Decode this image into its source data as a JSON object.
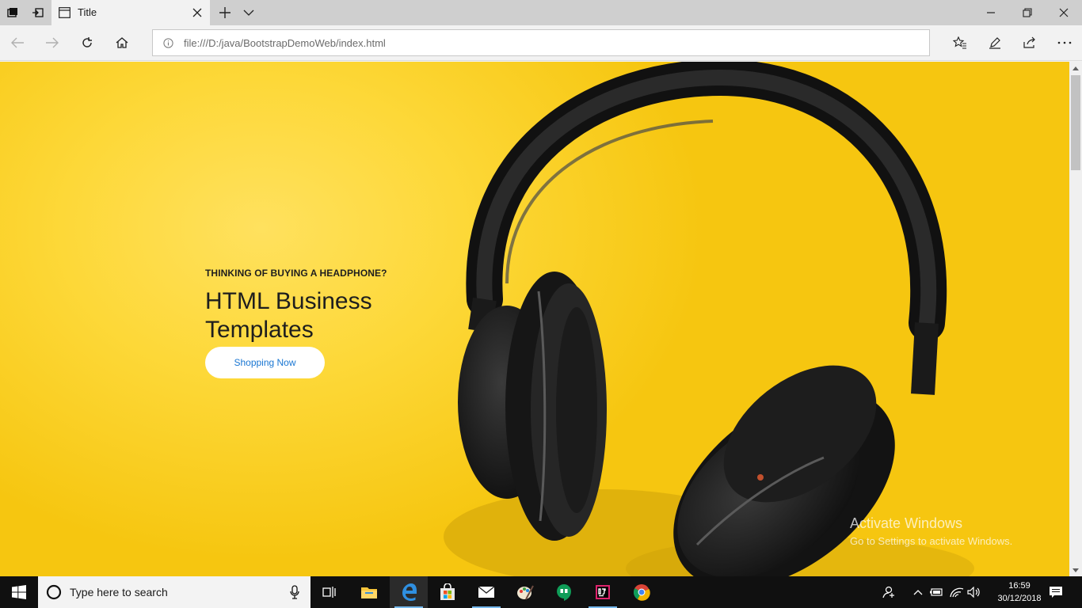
{
  "tab": {
    "title": "Title"
  },
  "address_bar": {
    "url": "file:///D:/java/BootstrapDemoWeb/index.html"
  },
  "page": {
    "eyebrow": "THINKING OF BUYING A HEADPHONE?",
    "headline": "HTML Business Templates",
    "cta_label": "Shopping Now"
  },
  "watermark": {
    "line1": "Activate Windows",
    "line2": "Go to Settings to activate Windows."
  },
  "taskbar": {
    "search_placeholder": "Type here to search",
    "clock_time": "16:59",
    "clock_date": "30/12/2018"
  },
  "colors": {
    "page_background": "#f9cf1f",
    "cta_text": "#1976d2",
    "taskbar": "#101010"
  }
}
